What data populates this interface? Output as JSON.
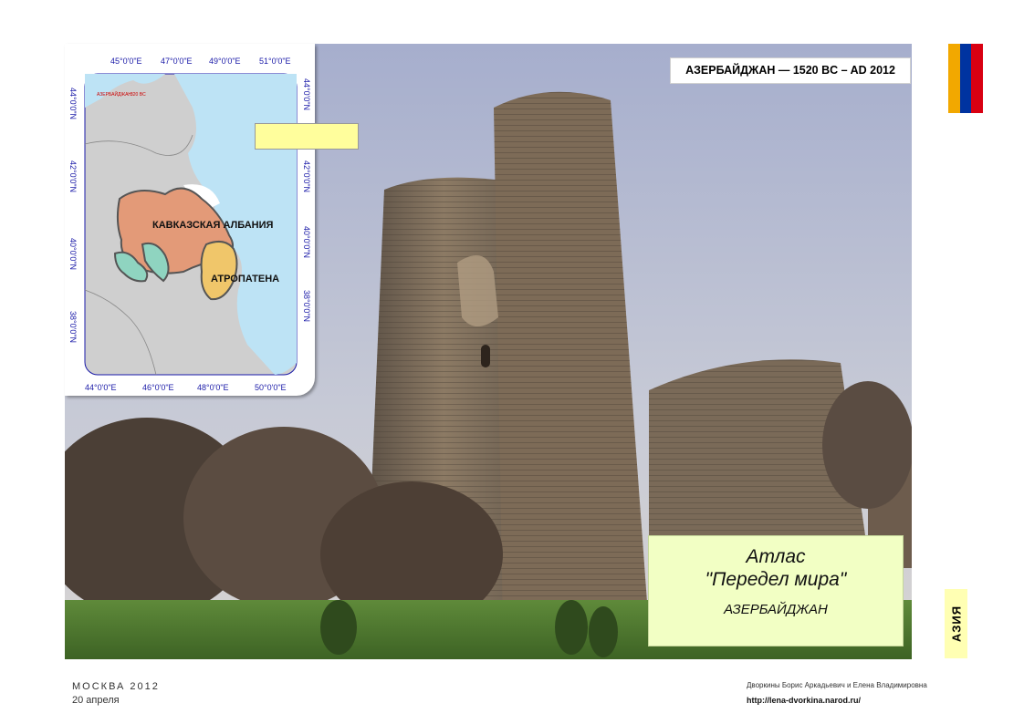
{
  "header": {
    "title": "АЗЕРБАЙДЖАН — 1520 BC – AD 2012"
  },
  "atlas": {
    "line1": "Атлас",
    "line2": "\"Передел мира\"",
    "line3": "АЗЕРБАЙДЖАН"
  },
  "side_tab": {
    "label": "АЗИЯ"
  },
  "flag": {
    "colors": [
      "#f2a800",
      "#0033a0",
      "#d90012"
    ]
  },
  "map": {
    "top_coords": [
      "45°0'0\"E",
      "47°0'0\"E",
      "49°0'0\"E",
      "51°0'0\"E"
    ],
    "bottom_coords": [
      "44°0'0\"E",
      "46°0'0\"E",
      "48°0'0\"E",
      "50°0'0\"E"
    ],
    "left_coords": [
      "44°0'0\"N",
      "42°0'0\"N",
      "40°0'0\"N",
      "38°0'0\"N"
    ],
    "right_coords": [
      "44°0'0\"N",
      "42°0'0\"N",
      "40°0'0\"N",
      "38°0'0\"N"
    ],
    "regions": [
      "КАВКАЗСКАЯ АЛБАНИЯ",
      "АТРОПАТЕНА"
    ],
    "small_label_1": "АЗЕРБАЙДЖАН",
    "small_label_2": "320 BC",
    "colors": {
      "sea": "#bde3f5",
      "land": "#cfcfcf",
      "albania": "#e39a78",
      "atropatena": "#f0c66a",
      "teal": "#8fd4c0"
    }
  },
  "footer": {
    "city": "МОСКВА   2012",
    "date": "20 апреля",
    "authors": "Дворкины Борис Аркадьевич и Елена Владимировна",
    "url": "http://lena-dvorkina.narod.ru/"
  }
}
